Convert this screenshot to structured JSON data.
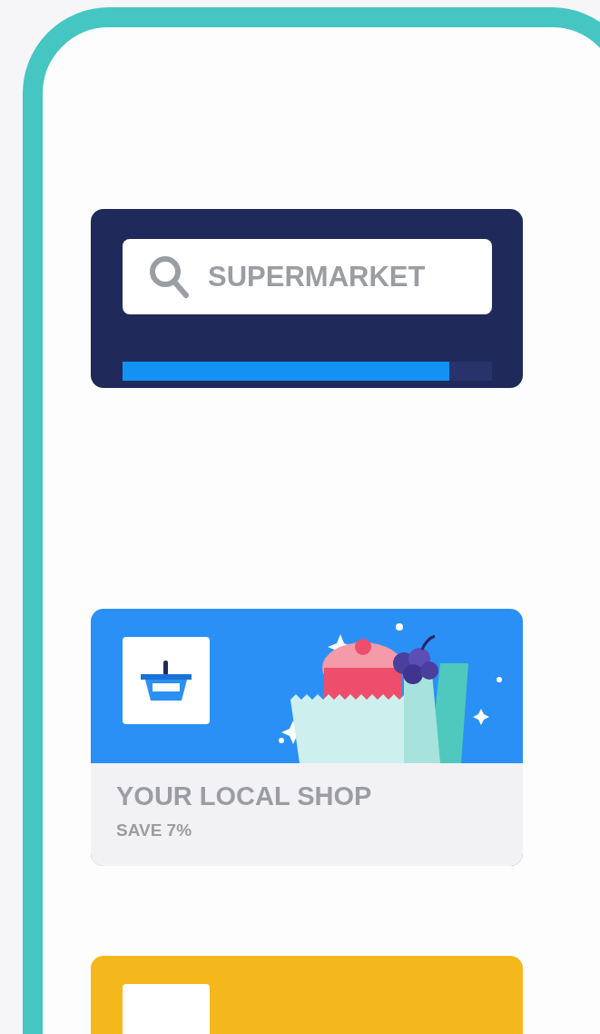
{
  "search": {
    "value": "SUPERMARKET",
    "progress": {
      "level": 0.885
    }
  },
  "offers": [
    {
      "color": "#2b90f5",
      "title": "YOUR LOCAL SHOP",
      "subtitle": "SAVE 7%"
    },
    {
      "color": "#f4b81c"
    }
  ]
}
